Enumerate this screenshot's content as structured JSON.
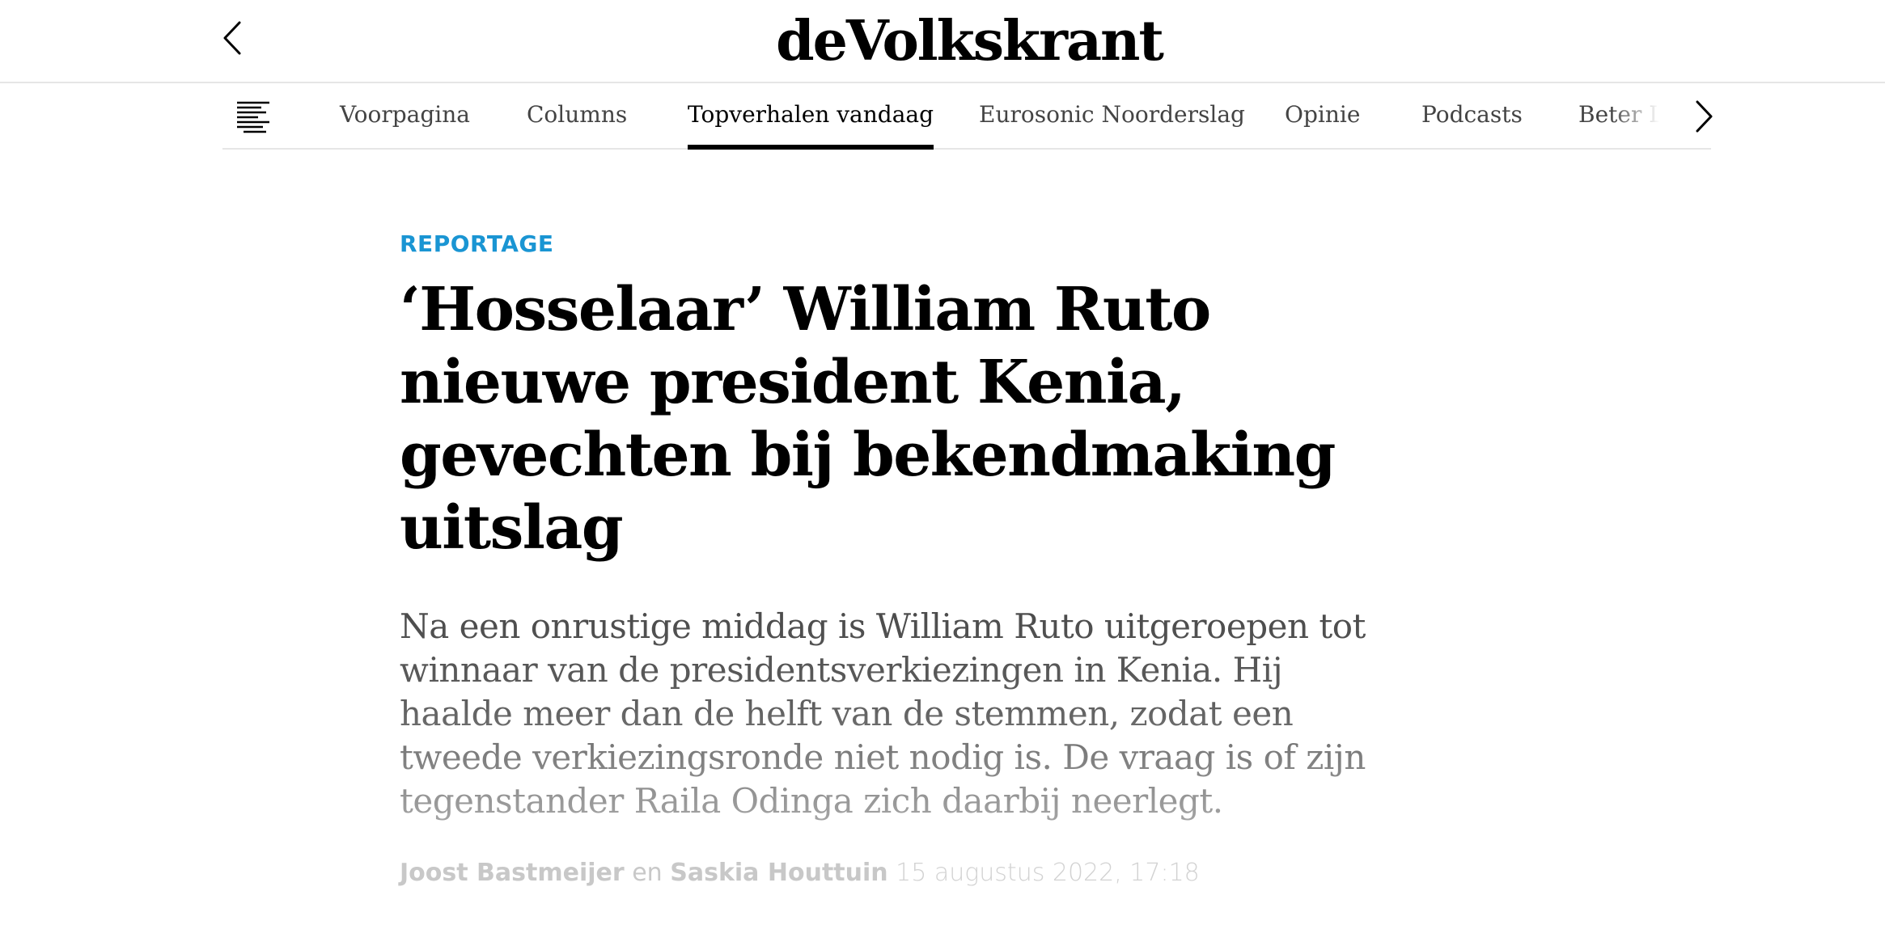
{
  "header": {
    "logo_text": "deVolkskrant",
    "back_icon": "chevron-left-icon"
  },
  "nav": {
    "menu_icon": "menu-list-icon",
    "items": [
      {
        "label": "Voorpagina",
        "active": false
      },
      {
        "label": "Columns",
        "active": false
      },
      {
        "label": "Topverhalen vandaag",
        "active": true
      },
      {
        "label": "Eurosonic Noorderslag",
        "active": false
      },
      {
        "label": "Opinie",
        "active": false
      },
      {
        "label": "Podcasts",
        "active": false
      },
      {
        "label": "Beter Le",
        "active": false
      }
    ],
    "next_icon": "chevron-right-icon"
  },
  "article": {
    "kicker": "REPORTAGE",
    "headline": "‘Hosselaar’ William Ruto nieuwe president Kenia, gevechten bij bekendmaking uitslag",
    "lead": "Na een onrustige middag is William Ruto uitgeroepen tot winnaar van de presidentsverkiezingen in Kenia. Hij haalde meer dan de helft van de stemmen, zodat een tweede verkiezingsronde niet nodig is. De vraag is of zijn tegenstander Raila Odinga zich daarbij neerlegt.",
    "byline": {
      "author1": "Joost Bastmeijer",
      "conjunction": "en",
      "author2": "Saskia Houttuin",
      "date": "15 augustus 2022, 17:18"
    }
  },
  "colors": {
    "kicker": "#1a95d3",
    "text": "#000000",
    "muted": "#c8c8c8"
  }
}
